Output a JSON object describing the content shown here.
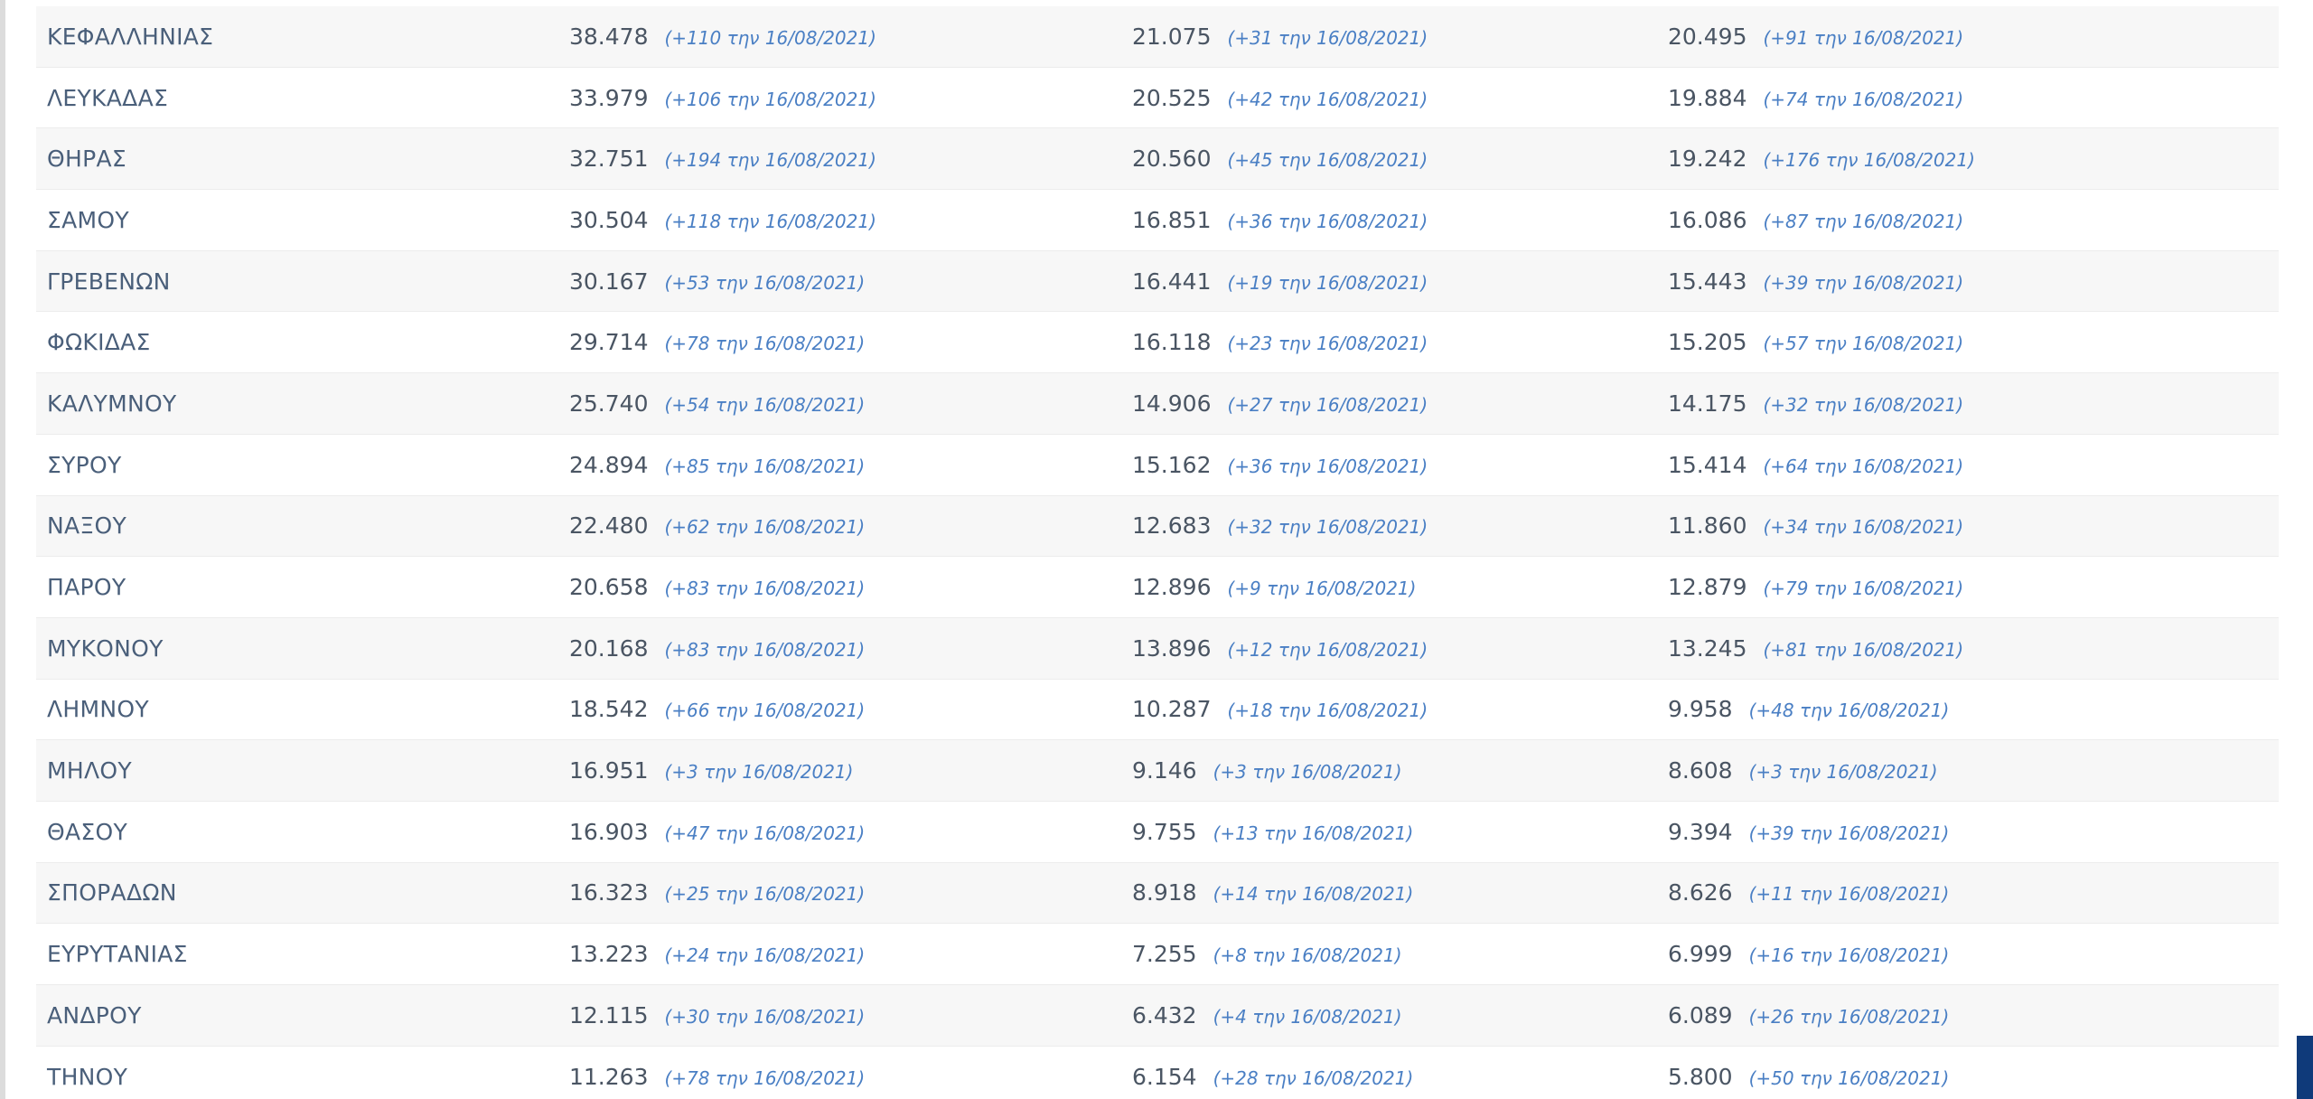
{
  "colors": {
    "name_text": "#4a5f7a",
    "number_text": "#4a5563",
    "delta_text": "#4a7fc4",
    "row_alt": "#f7f7f7",
    "accent": "#0f3a7a"
  },
  "rows": [
    {
      "name": "ΚΕΦΑΛΛΗΝΙΑΣ",
      "c1": {
        "num": "38.478",
        "delta": "(+110 την 16/08/2021)"
      },
      "c2": {
        "num": "21.075",
        "delta": "(+31 την 16/08/2021)"
      },
      "c3": {
        "num": "20.495",
        "delta": "(+91 την 16/08/2021)"
      }
    },
    {
      "name": "ΛΕΥΚΑΔΑΣ",
      "c1": {
        "num": "33.979",
        "delta": "(+106 την 16/08/2021)"
      },
      "c2": {
        "num": "20.525",
        "delta": "(+42 την 16/08/2021)"
      },
      "c3": {
        "num": "19.884",
        "delta": "(+74 την 16/08/2021)"
      }
    },
    {
      "name": "ΘΗΡΑΣ",
      "c1": {
        "num": "32.751",
        "delta": "(+194 την 16/08/2021)"
      },
      "c2": {
        "num": "20.560",
        "delta": "(+45 την 16/08/2021)"
      },
      "c3": {
        "num": "19.242",
        "delta": "(+176 την 16/08/2021)"
      }
    },
    {
      "name": "ΣΑΜΟΥ",
      "c1": {
        "num": "30.504",
        "delta": "(+118 την 16/08/2021)"
      },
      "c2": {
        "num": "16.851",
        "delta": "(+36 την 16/08/2021)"
      },
      "c3": {
        "num": "16.086",
        "delta": "(+87 την 16/08/2021)"
      }
    },
    {
      "name": "ΓΡΕΒΕΝΩΝ",
      "c1": {
        "num": "30.167",
        "delta": "(+53 την 16/08/2021)"
      },
      "c2": {
        "num": "16.441",
        "delta": "(+19 την 16/08/2021)"
      },
      "c3": {
        "num": "15.443",
        "delta": "(+39 την 16/08/2021)"
      }
    },
    {
      "name": "ΦΩΚΙΔΑΣ",
      "c1": {
        "num": "29.714",
        "delta": "(+78 την 16/08/2021)"
      },
      "c2": {
        "num": "16.118",
        "delta": "(+23 την 16/08/2021)"
      },
      "c3": {
        "num": "15.205",
        "delta": "(+57 την 16/08/2021)"
      }
    },
    {
      "name": "ΚΑΛΥΜΝΟΥ",
      "c1": {
        "num": "25.740",
        "delta": "(+54 την 16/08/2021)"
      },
      "c2": {
        "num": "14.906",
        "delta": "(+27 την 16/08/2021)"
      },
      "c3": {
        "num": "14.175",
        "delta": "(+32 την 16/08/2021)"
      }
    },
    {
      "name": "ΣΥΡΟΥ",
      "c1": {
        "num": "24.894",
        "delta": "(+85 την 16/08/2021)"
      },
      "c2": {
        "num": "15.162",
        "delta": "(+36 την 16/08/2021)"
      },
      "c3": {
        "num": "15.414",
        "delta": "(+64 την 16/08/2021)"
      }
    },
    {
      "name": "ΝΑΞΟΥ",
      "c1": {
        "num": "22.480",
        "delta": "(+62 την 16/08/2021)"
      },
      "c2": {
        "num": "12.683",
        "delta": "(+32 την 16/08/2021)"
      },
      "c3": {
        "num": "11.860",
        "delta": "(+34 την 16/08/2021)"
      }
    },
    {
      "name": "ΠΑΡΟΥ",
      "c1": {
        "num": "20.658",
        "delta": "(+83 την 16/08/2021)"
      },
      "c2": {
        "num": "12.896",
        "delta": "(+9 την 16/08/2021)"
      },
      "c3": {
        "num": "12.879",
        "delta": "(+79 την 16/08/2021)"
      }
    },
    {
      "name": "ΜΥΚΟΝΟΥ",
      "c1": {
        "num": "20.168",
        "delta": "(+83 την 16/08/2021)"
      },
      "c2": {
        "num": "13.896",
        "delta": "(+12 την 16/08/2021)"
      },
      "c3": {
        "num": "13.245",
        "delta": "(+81 την 16/08/2021)"
      }
    },
    {
      "name": "ΛΗΜΝΟΥ",
      "c1": {
        "num": "18.542",
        "delta": "(+66 την 16/08/2021)"
      },
      "c2": {
        "num": "10.287",
        "delta": "(+18 την 16/08/2021)"
      },
      "c3": {
        "num": "9.958",
        "delta": "(+48 την 16/08/2021)"
      }
    },
    {
      "name": "ΜΗΛΟΥ",
      "c1": {
        "num": "16.951",
        "delta": "(+3 την 16/08/2021)"
      },
      "c2": {
        "num": "9.146",
        "delta": "(+3 την 16/08/2021)"
      },
      "c3": {
        "num": "8.608",
        "delta": "(+3 την 16/08/2021)"
      }
    },
    {
      "name": "ΘΑΣΟΥ",
      "c1": {
        "num": "16.903",
        "delta": "(+47 την 16/08/2021)"
      },
      "c2": {
        "num": "9.755",
        "delta": "(+13 την 16/08/2021)"
      },
      "c3": {
        "num": "9.394",
        "delta": "(+39 την 16/08/2021)"
      }
    },
    {
      "name": "ΣΠΟΡΑΔΩΝ",
      "c1": {
        "num": "16.323",
        "delta": "(+25 την 16/08/2021)"
      },
      "c2": {
        "num": "8.918",
        "delta": "(+14 την 16/08/2021)"
      },
      "c3": {
        "num": "8.626",
        "delta": "(+11 την 16/08/2021)"
      }
    },
    {
      "name": "ΕΥΡΥΤΑΝΙΑΣ",
      "c1": {
        "num": "13.223",
        "delta": "(+24 την 16/08/2021)"
      },
      "c2": {
        "num": "7.255",
        "delta": "(+8 την 16/08/2021)"
      },
      "c3": {
        "num": "6.999",
        "delta": "(+16 την 16/08/2021)"
      }
    },
    {
      "name": "ΑΝΔΡΟΥ",
      "c1": {
        "num": "12.115",
        "delta": "(+30 την 16/08/2021)"
      },
      "c2": {
        "num": "6.432",
        "delta": "(+4 την 16/08/2021)"
      },
      "c3": {
        "num": "6.089",
        "delta": "(+26 την 16/08/2021)"
      }
    },
    {
      "name": "ΤΗΝΟΥ",
      "c1": {
        "num": "11.263",
        "delta": "(+78 την 16/08/2021)"
      },
      "c2": {
        "num": "6.154",
        "delta": "(+28 την 16/08/2021)"
      },
      "c3": {
        "num": "5.800",
        "delta": "(+50 την 16/08/2021)"
      }
    }
  ]
}
